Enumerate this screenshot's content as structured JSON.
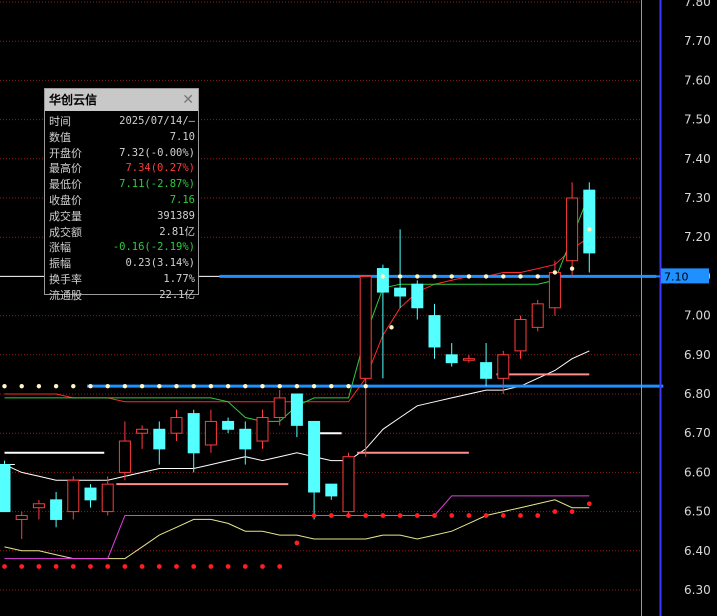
{
  "chart_data": {
    "type": "candlestick",
    "ylim": [
      6.26,
      7.82
    ],
    "yticks": [
      6.3,
      6.4,
      6.5,
      6.6,
      6.7,
      6.8,
      6.9,
      7.0,
      7.1,
      7.2,
      7.3,
      7.4,
      7.5,
      7.6,
      7.7,
      7.8
    ],
    "current_price_label": "7.10",
    "current_price": 7.1,
    "colors": {
      "up": "#ff3b3b",
      "down": "#54ffff",
      "grid": "#8a1a1a",
      "axis": "#3a3aff",
      "hline": "#1e90ff",
      "flag": "#1e90ff"
    },
    "candles": [
      {
        "o": 6.62,
        "h": 6.63,
        "l": 6.5,
        "c": 6.5
      },
      {
        "o": 6.48,
        "h": 6.5,
        "l": 6.43,
        "c": 6.49
      },
      {
        "o": 6.51,
        "h": 6.53,
        "l": 6.48,
        "c": 6.52
      },
      {
        "o": 6.53,
        "h": 6.55,
        "l": 6.46,
        "c": 6.48
      },
      {
        "o": 6.5,
        "h": 6.59,
        "l": 6.48,
        "c": 6.58
      },
      {
        "o": 6.56,
        "h": 6.57,
        "l": 6.51,
        "c": 6.53
      },
      {
        "o": 6.5,
        "h": 6.59,
        "l": 6.49,
        "c": 6.57
      },
      {
        "o": 6.6,
        "h": 6.73,
        "l": 6.58,
        "c": 6.68
      },
      {
        "o": 6.7,
        "h": 6.72,
        "l": 6.66,
        "c": 6.71
      },
      {
        "o": 6.71,
        "h": 6.73,
        "l": 6.62,
        "c": 6.66
      },
      {
        "o": 6.7,
        "h": 6.76,
        "l": 6.68,
        "c": 6.74
      },
      {
        "o": 6.75,
        "h": 6.76,
        "l": 6.6,
        "c": 6.65
      },
      {
        "o": 6.67,
        "h": 6.76,
        "l": 6.65,
        "c": 6.73
      },
      {
        "o": 6.73,
        "h": 6.74,
        "l": 6.7,
        "c": 6.71
      },
      {
        "o": 6.71,
        "h": 6.73,
        "l": 6.62,
        "c": 6.66
      },
      {
        "o": 6.68,
        "h": 6.76,
        "l": 6.66,
        "c": 6.74
      },
      {
        "o": 6.74,
        "h": 6.81,
        "l": 6.72,
        "c": 6.79
      },
      {
        "o": 6.8,
        "h": 6.8,
        "l": 6.69,
        "c": 6.72
      },
      {
        "o": 6.73,
        "h": 6.73,
        "l": 6.48,
        "c": 6.55
      },
      {
        "o": 6.57,
        "h": 6.57,
        "l": 6.53,
        "c": 6.54
      },
      {
        "o": 6.5,
        "h": 6.65,
        "l": 6.49,
        "c": 6.64
      },
      {
        "o": 6.84,
        "h": 7.1,
        "l": 6.64,
        "c": 7.1
      },
      {
        "o": 7.12,
        "h": 7.13,
        "l": 6.84,
        "c": 7.06
      },
      {
        "o": 7.07,
        "h": 7.22,
        "l": 7.02,
        "c": 7.05
      },
      {
        "o": 7.08,
        "h": 7.09,
        "l": 6.99,
        "c": 7.02
      },
      {
        "o": 7.0,
        "h": 7.03,
        "l": 6.89,
        "c": 6.92
      },
      {
        "o": 6.9,
        "h": 6.93,
        "l": 6.87,
        "c": 6.88
      },
      {
        "o": 6.89,
        "h": 6.9,
        "l": 6.88,
        "c": 6.89
      },
      {
        "o": 6.88,
        "h": 6.93,
        "l": 6.82,
        "c": 6.84
      },
      {
        "o": 6.84,
        "h": 6.91,
        "l": 6.8,
        "c": 6.9
      },
      {
        "o": 6.91,
        "h": 7.0,
        "l": 6.89,
        "c": 6.99
      },
      {
        "o": 6.97,
        "h": 7.04,
        "l": 6.96,
        "c": 7.03
      },
      {
        "o": 7.02,
        "h": 7.14,
        "l": 7.0,
        "c": 7.11
      },
      {
        "o": 7.14,
        "h": 7.34,
        "l": 7.1,
        "c": 7.3
      },
      {
        "o": 7.32,
        "h": 7.34,
        "l": 7.11,
        "c": 7.16
      }
    ],
    "series": [
      {
        "color": "#ff2a2a",
        "values": [
          6.8,
          6.8,
          6.8,
          6.8,
          6.79,
          6.79,
          6.79,
          6.78,
          6.78,
          6.78,
          6.78,
          6.78,
          6.78,
          6.78,
          6.78,
          6.78,
          6.78,
          6.78,
          6.78,
          6.78,
          6.78,
          6.84,
          6.95,
          7.02,
          7.06,
          7.08,
          7.09,
          7.1,
          7.1,
          7.11,
          7.11,
          7.12,
          7.13,
          7.17,
          7.2
        ]
      },
      {
        "color": "#2ecc40",
        "values": [
          6.79,
          6.79,
          6.79,
          6.79,
          6.79,
          6.79,
          6.79,
          6.79,
          6.79,
          6.79,
          6.79,
          6.79,
          6.79,
          6.78,
          6.74,
          6.73,
          6.73,
          6.77,
          6.79,
          6.79,
          6.79,
          6.95,
          7.07,
          7.08,
          7.08,
          7.08,
          7.08,
          7.08,
          7.08,
          7.08,
          7.08,
          7.08,
          7.09,
          7.2,
          7.31
        ]
      },
      {
        "color": "#ffffff",
        "values": [
          6.62,
          6.6,
          6.59,
          6.58,
          6.58,
          6.58,
          6.58,
          6.59,
          6.6,
          6.61,
          6.61,
          6.61,
          6.62,
          6.63,
          6.64,
          6.63,
          6.64,
          6.65,
          6.64,
          6.63,
          6.63,
          6.66,
          6.71,
          6.74,
          6.77,
          6.78,
          6.79,
          6.8,
          6.81,
          6.81,
          6.82,
          6.84,
          6.86,
          6.89,
          6.91
        ]
      },
      {
        "color": "#e6e68c",
        "values": [
          6.41,
          6.4,
          6.4,
          6.39,
          6.38,
          6.38,
          6.38,
          6.38,
          6.41,
          6.44,
          6.46,
          6.48,
          6.48,
          6.47,
          6.45,
          6.45,
          6.44,
          6.44,
          6.43,
          6.43,
          6.43,
          6.43,
          6.44,
          6.44,
          6.43,
          6.44,
          6.45,
          6.47,
          6.49,
          6.5,
          6.51,
          6.52,
          6.53,
          6.51,
          6.51
        ]
      },
      {
        "color": "#e040e0",
        "values": [
          6.38,
          6.38,
          6.38,
          6.38,
          6.38,
          6.38,
          6.38,
          6.49,
          6.49,
          6.49,
          6.49,
          6.49,
          6.49,
          6.49,
          6.49,
          6.49,
          6.49,
          6.49,
          6.49,
          6.49,
          6.49,
          6.49,
          6.49,
          6.49,
          6.49,
          6.49,
          6.54,
          6.54,
          6.54,
          6.54,
          6.54,
          6.54,
          6.54,
          6.54,
          6.54
        ]
      }
    ],
    "dots_white": [
      [
        0,
        6.82
      ],
      [
        1,
        6.82
      ],
      [
        2,
        6.82
      ],
      [
        3,
        6.82
      ],
      [
        4,
        6.82
      ],
      [
        5,
        6.82
      ],
      [
        6,
        6.82
      ],
      [
        7,
        6.82
      ],
      [
        8,
        6.82
      ],
      [
        9,
        6.82
      ],
      [
        10,
        6.82
      ],
      [
        11,
        6.82
      ],
      [
        12,
        6.82
      ],
      [
        13,
        6.82
      ],
      [
        14,
        6.82
      ],
      [
        15,
        6.82
      ],
      [
        16,
        6.82
      ],
      [
        17,
        6.82
      ],
      [
        18,
        6.82
      ],
      [
        19,
        6.82
      ],
      [
        20,
        6.82
      ],
      [
        21,
        6.82
      ],
      [
        22,
        7.1
      ],
      [
        23,
        7.1
      ],
      [
        24,
        7.1
      ],
      [
        25,
        7.1
      ],
      [
        26,
        7.1
      ],
      [
        27,
        7.1
      ],
      [
        28,
        7.1
      ],
      [
        29,
        7.1
      ],
      [
        30,
        7.1
      ],
      [
        31,
        7.1
      ],
      [
        32,
        7.11
      ],
      [
        33,
        7.12
      ],
      [
        34,
        7.22
      ],
      [
        22.5,
        6.97
      ]
    ],
    "dots_red": [
      [
        0,
        6.36
      ],
      [
        1,
        6.36
      ],
      [
        2,
        6.36
      ],
      [
        3,
        6.36
      ],
      [
        4,
        6.36
      ],
      [
        5,
        6.36
      ],
      [
        6,
        6.36
      ],
      [
        7,
        6.36
      ],
      [
        8,
        6.36
      ],
      [
        9,
        6.36
      ],
      [
        10,
        6.36
      ],
      [
        11,
        6.36
      ],
      [
        12,
        6.36
      ],
      [
        13,
        6.36
      ],
      [
        14,
        6.36
      ],
      [
        15,
        6.36
      ],
      [
        16,
        6.36
      ],
      [
        17,
        6.42
      ],
      [
        18,
        6.49
      ],
      [
        19,
        6.49
      ],
      [
        20,
        6.49
      ],
      [
        21,
        6.49
      ],
      [
        22,
        6.49
      ],
      [
        23,
        6.49
      ],
      [
        24,
        6.49
      ],
      [
        25,
        6.49
      ],
      [
        26,
        6.49
      ],
      [
        27,
        6.49
      ],
      [
        28,
        6.49
      ],
      [
        29,
        6.49
      ],
      [
        30,
        6.49
      ],
      [
        31,
        6.49
      ],
      [
        32,
        6.5
      ],
      [
        33,
        6.5
      ],
      [
        34,
        6.52
      ]
    ],
    "segments": [
      {
        "x0": 0,
        "x1": 5.8,
        "y": 6.65,
        "color": "#ffffff"
      },
      {
        "x0": 17.8,
        "x1": 19.6,
        "y": 6.7,
        "color": "#ffffff"
      },
      {
        "x0": 6.5,
        "x1": 16.5,
        "y": 6.57,
        "color": "#ff8c8c"
      },
      {
        "x0": 20.5,
        "x1": 27.0,
        "y": 6.65,
        "color": "#ff8c8c"
      },
      {
        "x0": 28.6,
        "x1": 34.0,
        "y": 6.85,
        "color": "#ff8c8c"
      },
      {
        "x0": 4.8,
        "x1": 38.3,
        "y": 6.82,
        "color": "#1e90ff"
      },
      {
        "x0": 12.5,
        "x1": 37.9,
        "y": 7.1,
        "color": "#1e90ff"
      }
    ],
    "tail_lines": [
      [
        -0.5,
        6.62,
        0.6,
        6.62
      ],
      [
        -0.5,
        7.1,
        12.5,
        7.1
      ]
    ]
  },
  "info_panel": {
    "title": "华创云信",
    "close_icon": "close-icon",
    "rows": [
      {
        "label": "时间",
        "value": "2025/07/14/—",
        "color": "#d0d0d0"
      },
      {
        "label": "数值",
        "value": "7.10",
        "color": "#d0d0d0"
      },
      {
        "label": "开盘价",
        "value": "7.32(-0.00%)",
        "color": "#d0d0d0"
      },
      {
        "label": "最高价",
        "value": "7.34(0.27%)",
        "color": "#ff3b3b"
      },
      {
        "label": "最低价",
        "value": "7.11(-2.87%)",
        "color": "#2ecc40"
      },
      {
        "label": "收盘价",
        "value": "7.16",
        "color": "#2ecc40"
      },
      {
        "label": "成交量",
        "value": "391389",
        "color": "#d0d0d0"
      },
      {
        "label": "成交额",
        "value": "2.81亿",
        "color": "#d0d0d0"
      },
      {
        "label": "涨幅",
        "value": "-0.16(-2.19%)",
        "color": "#2ecc40"
      },
      {
        "label": "振幅",
        "value": "0.23(3.14%)",
        "color": "#d0d0d0"
      },
      {
        "label": "换手率",
        "value": "1.77%",
        "color": "#d0d0d0"
      },
      {
        "label": "流通股",
        "value": "22.1亿",
        "color": "#d0d0d0"
      }
    ]
  }
}
